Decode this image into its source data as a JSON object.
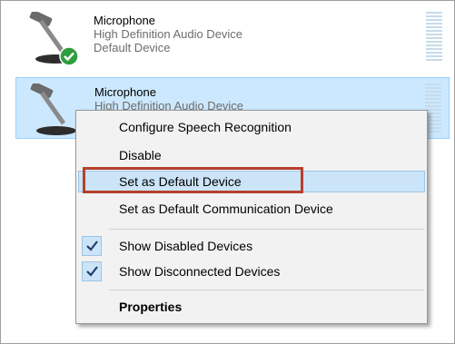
{
  "devices": [
    {
      "name": "Microphone",
      "description": "High Definition Audio Device",
      "status": "Default Device",
      "icon": "microphone-icon",
      "badge": "default-check-badge-icon"
    },
    {
      "name": "Microphone",
      "description": "High Definition Audio Device",
      "status": "",
      "icon": "microphone-icon"
    }
  ],
  "context_menu": {
    "items": [
      {
        "label": "Configure Speech Recognition"
      },
      {
        "label": "Disable"
      },
      {
        "label": "Set as Default Device",
        "highlighted": true
      },
      {
        "label": "Set as Default Communication Device"
      },
      {
        "label": "Show Disabled Devices",
        "checked": true
      },
      {
        "label": "Show Disconnected Devices",
        "checked": true
      },
      {
        "label": "Properties",
        "bold": true
      }
    ]
  },
  "colors": {
    "selection": "#cce8ff",
    "menu_highlight": "#cce4f7",
    "callout": "#b5402c",
    "check_badge": "#2e9e3e"
  }
}
